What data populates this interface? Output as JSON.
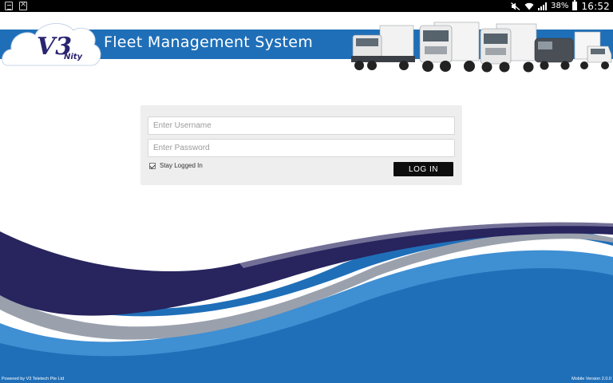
{
  "status_bar": {
    "left_icons": [
      "document-icon",
      "close-box-icon"
    ],
    "battery_percent": "38%",
    "time": "16:52"
  },
  "header": {
    "logo_text_main": "V3",
    "logo_text_sub": "Nity",
    "app_title": "Fleet Management System",
    "brand_color": "#1f6fb8",
    "logo_color": "#2a2570"
  },
  "login": {
    "username_placeholder": "Enter Username",
    "password_placeholder": "Enter Password",
    "stay_logged_in_label": "Stay Logged In",
    "stay_logged_in_checked": true,
    "login_button_label": "LOG IN"
  },
  "footer": {
    "powered_by": "Powered by V3 Teletech Pte Ltd",
    "version": "Mobile Version 2.0.0"
  },
  "colors": {
    "swoosh_dark": "#27245e",
    "swoosh_blue": "#1f6fb8",
    "swoosh_light_blue": "#3f8fd3",
    "panel_bg": "#eeeeee",
    "button_bg": "#0d0d0d"
  }
}
